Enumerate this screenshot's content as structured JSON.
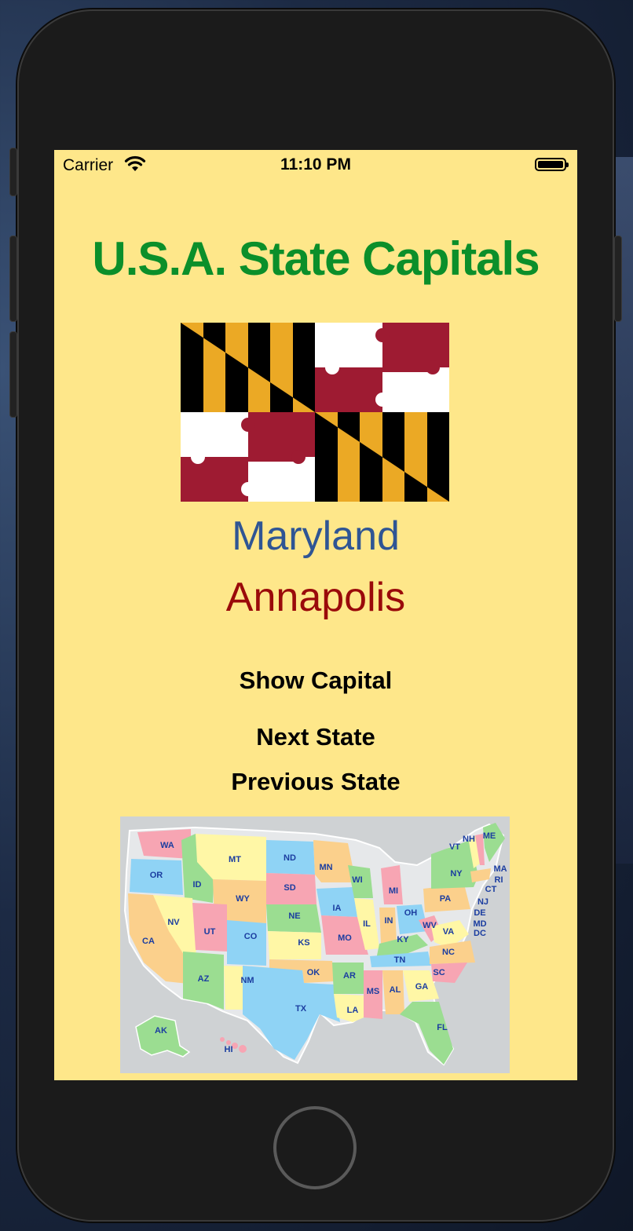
{
  "status_bar": {
    "carrier": "Carrier",
    "time": "11:10 PM",
    "icons": [
      "wifi-icon",
      "battery-icon"
    ]
  },
  "app": {
    "title": "U.S.A. State Capitals",
    "state": "Maryland",
    "capital": "Annapolis",
    "buttons": {
      "show_capital": "Show Capital",
      "next_state": "Next State",
      "previous_state": "Previous State"
    }
  },
  "map_labels": [
    "WA",
    "OR",
    "CA",
    "ID",
    "NV",
    "MT",
    "WY",
    "UT",
    "AZ",
    "CO",
    "NM",
    "ND",
    "SD",
    "NE",
    "KS",
    "OK",
    "TX",
    "MN",
    "IA",
    "MO",
    "AR",
    "LA",
    "WI",
    "IL",
    "MS",
    "MI",
    "IN",
    "KY",
    "TN",
    "AL",
    "OH",
    "GA",
    "FL",
    "WV",
    "VA",
    "NC",
    "SC",
    "PA",
    "NY",
    "VT",
    "NH",
    "ME",
    "MA",
    "RI",
    "CT",
    "NJ",
    "DE",
    "MD",
    "DC",
    "AK",
    "HI"
  ],
  "colors": {
    "background": "#fee78a",
    "title": "#0b8f2a",
    "state": "#2f5594",
    "capital": "#9a0a0a"
  }
}
